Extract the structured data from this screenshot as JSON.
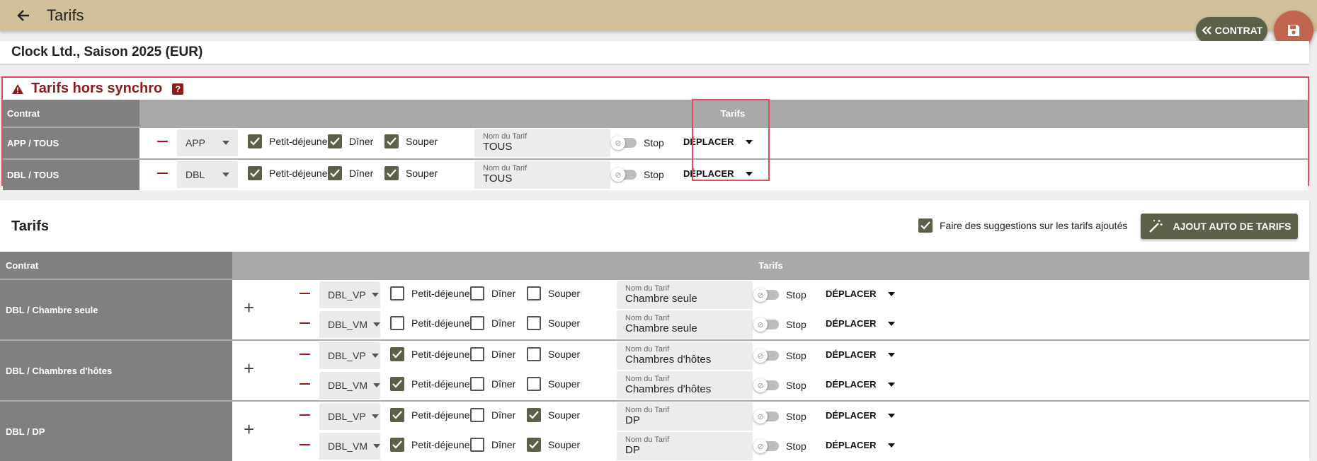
{
  "topbar": {
    "title": "Tarifs",
    "contrat_label": "CONTRAT"
  },
  "header": {
    "title": "Clock Ltd., Saison 2025 (EUR)"
  },
  "sync": {
    "title": "Tarifs hors synchro",
    "help_glyph": "?",
    "col_contrat": "Contrat",
    "col_tarifs": "Tarifs",
    "rows": [
      {
        "label": "APP / TOUS",
        "select": "APP",
        "breakfast": "Petit-déjeuner",
        "breakfast_on": true,
        "dinner": "Dîner",
        "dinner_on": true,
        "supper": "Souper",
        "supper_on": true,
        "nom_label": "Nom du Tarif",
        "nom_value": "TOUS",
        "stop": "Stop",
        "move": "DÉPLACER"
      },
      {
        "label": "DBL / TOUS",
        "select": "DBL",
        "breakfast": "Petit-déjeuner",
        "breakfast_on": true,
        "dinner": "Dîner",
        "dinner_on": true,
        "supper": "Souper",
        "supper_on": true,
        "nom_label": "Nom du Tarif",
        "nom_value": "TOUS",
        "stop": "Stop",
        "move": "DÉPLACER"
      }
    ]
  },
  "tarifs": {
    "title": "Tarifs",
    "suggest_label": "Faire des suggestions sur les tarifs ajoutés",
    "suggest_on": true,
    "auto_button": "AJOUT AUTO DE TARIFS",
    "col_contrat": "Contrat",
    "col_tarifs": "Tarifs",
    "groups": [
      {
        "label": "DBL / Chambre seule",
        "rows": [
          {
            "select": "DBL_VP",
            "breakfast": "Petit-déjeuner",
            "breakfast_on": false,
            "dinner": "Dîner",
            "dinner_on": false,
            "supper": "Souper",
            "supper_on": false,
            "nom_label": "Nom du Tarif",
            "nom_value": "Chambre seule",
            "stop": "Stop",
            "move": "DÉPLACER"
          },
          {
            "select": "DBL_VM",
            "breakfast": "Petit-déjeuner",
            "breakfast_on": false,
            "dinner": "Dîner",
            "dinner_on": false,
            "supper": "Souper",
            "supper_on": false,
            "nom_label": "Nom du Tarif",
            "nom_value": "Chambre seule",
            "stop": "Stop",
            "move": "DÉPLACER"
          }
        ]
      },
      {
        "label": "DBL / Chambres d'hôtes",
        "rows": [
          {
            "select": "DBL_VP",
            "breakfast": "Petit-déjeuner",
            "breakfast_on": true,
            "dinner": "Dîner",
            "dinner_on": false,
            "supper": "Souper",
            "supper_on": false,
            "nom_label": "Nom du Tarif",
            "nom_value": "Chambres d'hôtes",
            "stop": "Stop",
            "move": "DÉPLACER"
          },
          {
            "select": "DBL_VM",
            "breakfast": "Petit-déjeuner",
            "breakfast_on": true,
            "dinner": "Dîner",
            "dinner_on": false,
            "supper": "Souper",
            "supper_on": false,
            "nom_label": "Nom du Tarif",
            "nom_value": "Chambres d'hôtes",
            "stop": "Stop",
            "move": "DÉPLACER"
          }
        ]
      },
      {
        "label": "DBL / DP",
        "rows": [
          {
            "select": "DBL_VP",
            "breakfast": "Petit-déjeuner",
            "breakfast_on": true,
            "dinner": "Dîner",
            "dinner_on": false,
            "supper": "Souper",
            "supper_on": true,
            "nom_label": "Nom du Tarif",
            "nom_value": "DP",
            "stop": "Stop",
            "move": "DÉPLACER"
          },
          {
            "select": "DBL_VM",
            "breakfast": "Petit-déjeuner",
            "breakfast_on": true,
            "dinner": "Dîner",
            "dinner_on": false,
            "supper": "Souper",
            "supper_on": true,
            "nom_label": "Nom du Tarif",
            "nom_value": "DP",
            "stop": "Stop",
            "move": "DÉPLACER"
          }
        ]
      }
    ]
  },
  "icons": {
    "back": "arrow-left-icon",
    "contrat": "double-chevron-left-icon",
    "save": "floppy-disk-icon",
    "warning": "warning-triangle-icon",
    "wand": "magic-wand-icon",
    "add": "plus-icon",
    "remove": "minus-icon"
  },
  "colors": {
    "topbar": "#d1c09a",
    "accent_green": "#5b6149",
    "save_red": "#c2654f",
    "warning_red": "#8c1c1c",
    "highlight_border": "#e34b57"
  }
}
